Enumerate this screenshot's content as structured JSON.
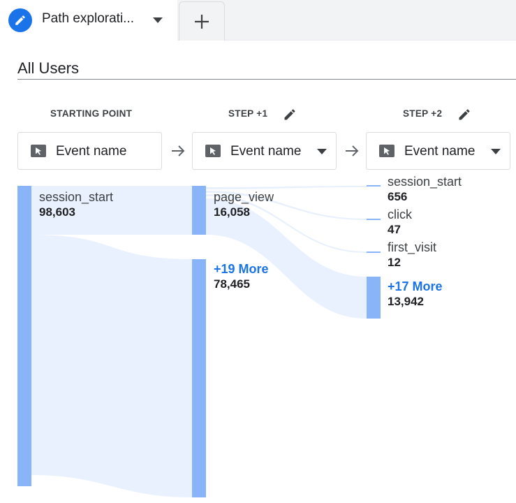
{
  "tabs": {
    "active_title": "Path explorati...",
    "add_label": "+"
  },
  "segment": {
    "title": "All Users"
  },
  "steps": [
    {
      "header": "STARTING POINT",
      "node_type": "Event name",
      "dropdown": false
    },
    {
      "header": "STEP +1",
      "node_type": "Event name",
      "dropdown": true
    },
    {
      "header": "STEP +2",
      "node_type": "Event name",
      "dropdown": true
    }
  ],
  "nodes": {
    "start": [
      {
        "name": "session_start",
        "count": "98,603"
      }
    ],
    "step1": [
      {
        "name": "page_view",
        "count": "16,058"
      },
      {
        "name": "+19 More",
        "count": "78,465"
      }
    ],
    "step2": [
      {
        "name": "session_start",
        "count": "656"
      },
      {
        "name": "click",
        "count": "47"
      },
      {
        "name": "first_visit",
        "count": "12"
      },
      {
        "name": "+17 More",
        "count": "13,942"
      }
    ]
  },
  "colors": {
    "accent": "#1a73e8",
    "node_bar": "#8ab4f8",
    "flow": "#e8f0fe"
  },
  "icons": [
    "pencil-icon",
    "add-icon",
    "chevron-down-icon",
    "arrow-right-icon",
    "cursor-icon"
  ]
}
